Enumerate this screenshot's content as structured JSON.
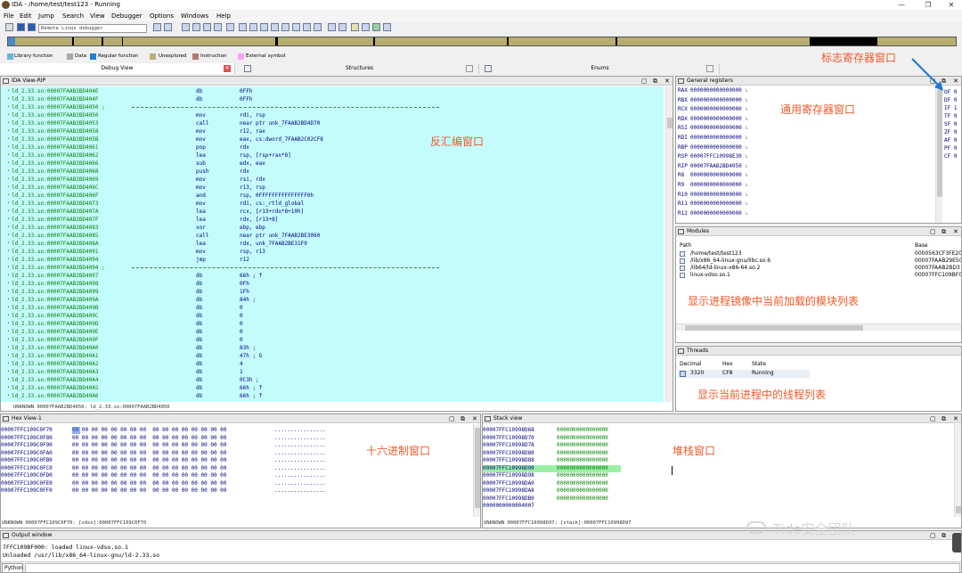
{
  "window": {
    "title": "IDA - /home/test/test123 - Running",
    "min": "—",
    "max": "❐",
    "close": "✕"
  },
  "menu": [
    "File",
    "Edit",
    "Jump",
    "Search",
    "View",
    "Debugger",
    "Options",
    "Windows",
    "Help"
  ],
  "debugger_select": "Remote Linux debugger",
  "legend": [
    {
      "label": "Library function",
      "color": "#69b3d7"
    },
    {
      "label": "Data",
      "color": "#a8a8a8"
    },
    {
      "label": "Regular function",
      "color": "#1f7ed6"
    },
    {
      "label": "Unexplored",
      "color": "#b9b17a"
    },
    {
      "label": "Instruction",
      "color": "#b3796b"
    },
    {
      "label": "External symbol",
      "color": "#ff9ff5"
    }
  ],
  "tabs": [
    {
      "label": "Debug View"
    },
    {
      "label": "Structures"
    },
    {
      "label": "Enums"
    }
  ],
  "ida_view": {
    "title": "IDA View-RIP",
    "status": "UNKNOWN 00007FAAB2BD4050: ld_2.33.so:00007FAAB2BD4050",
    "lines": [
      {
        "addr": "ld_2.33.so:00007FAAB2BD404E",
        "mn": "db",
        "op": "0FFh"
      },
      {
        "addr": "ld_2.33.so:00007FAAB2BD404F",
        "mn": "db",
        "op": "0FFh"
      },
      {
        "addr": "ld_2.33.so:00007FAAB2BD4050 ;",
        "mn": "",
        "op": ""
      },
      {
        "addr": "ld_2.33.so:00007FAAB2BD4050",
        "mn": "mov",
        "op": "rdi, rsp"
      },
      {
        "addr": "ld_2.33.so:00007FAAB2BD4053",
        "mn": "call",
        "op": "near ptr unk_7FAAB2BD4D70"
      },
      {
        "addr": "ld_2.33.so:00007FAAB2BD4058",
        "mn": "mov",
        "op": "r12, rax"
      },
      {
        "addr": "ld_2.33.so:00007FAAB2BD405B",
        "mn": "mov",
        "op": "eax, cs:dword_7FAAB2C02CF8"
      },
      {
        "addr": "ld_2.33.so:00007FAAB2BD4061",
        "mn": "pop",
        "op": "rdx"
      },
      {
        "addr": "ld_2.33.so:00007FAAB2BD4062",
        "mn": "lea",
        "op": "rsp, [rsp+rax*8]"
      },
      {
        "addr": "ld_2.33.so:00007FAAB2BD4066",
        "mn": "sub",
        "op": "edx, eax"
      },
      {
        "addr": "ld_2.33.so:00007FAAB2BD4068",
        "mn": "push",
        "op": "rdx"
      },
      {
        "addr": "ld_2.33.so:00007FAAB2BD4069",
        "mn": "mov",
        "op": "rsi, rdx"
      },
      {
        "addr": "ld_2.33.so:00007FAAB2BD406C",
        "mn": "mov",
        "op": "r13, rsp"
      },
      {
        "addr": "ld_2.33.so:00007FAAB2BD406F",
        "mn": "and",
        "op": "rsp, 0FFFFFFFFFFFFFFF0h"
      },
      {
        "addr": "ld_2.33.so:00007FAAB2BD4073",
        "mn": "mov",
        "op": "rdi, cs:_rtld_global"
      },
      {
        "addr": "ld_2.33.so:00007FAAB2BD407A",
        "mn": "lea",
        "op": "rcx, [r13+rdx*8+10h]"
      },
      {
        "addr": "ld_2.33.so:00007FAAB2BD407F",
        "mn": "lea",
        "op": "rdx, [r13+8]"
      },
      {
        "addr": "ld_2.33.so:00007FAAB2BD4083",
        "mn": "xor",
        "op": "ebp, ebp"
      },
      {
        "addr": "ld_2.33.so:00007FAAB2BD4085",
        "mn": "call",
        "op": "near ptr unk_7FAAB2BE3060"
      },
      {
        "addr": "ld_2.33.so:00007FAAB2BD408A",
        "mn": "lea",
        "op": "rdx, unk_7FAAB2BE31F0"
      },
      {
        "addr": "ld_2.33.so:00007FAAB2BD4091",
        "mn": "mov",
        "op": "rsp, r13"
      },
      {
        "addr": "ld_2.33.so:00007FAAB2BD4094",
        "mn": "jmp",
        "op": "r12"
      },
      {
        "addr": "ld_2.33.so:00007FAAB2BD4094 ;",
        "mn": "",
        "op": ""
      },
      {
        "addr": "ld_2.33.so:00007FAAB2BD4097",
        "mn": "db",
        "op": "66h ; f"
      },
      {
        "addr": "ld_2.33.so:00007FAAB2BD4098",
        "mn": "db",
        "op": "0Fh"
      },
      {
        "addr": "ld_2.33.so:00007FAAB2BD4099",
        "mn": "db",
        "op": "1Fh"
      },
      {
        "addr": "ld_2.33.so:00007FAAB2BD409A",
        "mn": "db",
        "op": "84h ;"
      },
      {
        "addr": "ld_2.33.so:00007FAAB2BD409B",
        "mn": "db",
        "op": "0"
      },
      {
        "addr": "ld_2.33.so:00007FAAB2BD409C",
        "mn": "db",
        "op": "0"
      },
      {
        "addr": "ld_2.33.so:00007FAAB2BD409D",
        "mn": "db",
        "op": "0"
      },
      {
        "addr": "ld_2.33.so:00007FAAB2BD409E",
        "mn": "db",
        "op": "0"
      },
      {
        "addr": "ld_2.33.so:00007FAAB2BD409F",
        "mn": "db",
        "op": "0"
      },
      {
        "addr": "ld_2.33.so:00007FAAB2BD40A0",
        "mn": "db",
        "op": "83h ;"
      },
      {
        "addr": "ld_2.33.so:00007FAAB2BD40A1",
        "mn": "db",
        "op": "47h ; G"
      },
      {
        "addr": "ld_2.33.so:00007FAAB2BD40A2",
        "mn": "db",
        "op": "4"
      },
      {
        "addr": "ld_2.33.so:00007FAAB2BD40A3",
        "mn": "db",
        "op": "1"
      },
      {
        "addr": "ld_2.33.so:00007FAAB2BD40A4",
        "mn": "db",
        "op": "0C3h ;"
      },
      {
        "addr": "ld_2.33.so:00007FAAB2BD40A5",
        "mn": "db",
        "op": "66h ; f"
      },
      {
        "addr": "ld_2.33.so:00007FAAB2BD40A6",
        "mn": "db",
        "op": "66h ; f"
      }
    ]
  },
  "registers": {
    "title": "General registers",
    "rows": [
      {
        "name": "RAX",
        "val": "0000000000000000"
      },
      {
        "name": "RBX",
        "val": "0000000000000000"
      },
      {
        "name": "RCX",
        "val": "0000000000000000"
      },
      {
        "name": "RDX",
        "val": "0000000000000000"
      },
      {
        "name": "RSI",
        "val": "0000000000000000"
      },
      {
        "name": "RDI",
        "val": "0000000000000000"
      },
      {
        "name": "RBP",
        "val": "0000000000000000"
      },
      {
        "name": "RSP",
        "val": "00007FFC10998E30"
      },
      {
        "name": "RIP",
        "val": "00007FAAB2BD4050"
      },
      {
        "name": "R8",
        "val": "0000000000000000"
      },
      {
        "name": "R9",
        "val": "0000000000000000"
      },
      {
        "name": "R10",
        "val": "0000000000000000"
      },
      {
        "name": "R11",
        "val": "0000000000000000"
      },
      {
        "name": "R12",
        "val": "0000000000000000"
      }
    ],
    "flags": [
      "OF 0",
      "DF 0",
      "IF 1",
      "TF 0",
      "SF 0",
      "ZF 0",
      "AF 0",
      "PF 0",
      "CF 0"
    ]
  },
  "modules": {
    "title": "Modules",
    "col_path": "Path",
    "col_base": "Base",
    "rows": [
      {
        "path": "/home/test/test123",
        "base": "0000563CF3FE20"
      },
      {
        "path": "/lib/x86_64-linux-gnu/libc.so.6",
        "base": "00007FAAB29E50"
      },
      {
        "path": "/lib64/ld-linux-x86-64.so.2",
        "base": "00007FAAB2BD3"
      },
      {
        "path": "linux-vdso.so.1",
        "base": "00007FFC109BF0"
      }
    ]
  },
  "threads": {
    "title": "Threads",
    "cols": [
      "Decimal",
      "Hex",
      "State"
    ],
    "rows": [
      {
        "dec": "3320",
        "hex": "CF8",
        "state": "Running"
      }
    ]
  },
  "hexview": {
    "title": "Hex View-1",
    "status": "UNKNOWN 00007FFC109C0F70: [vdso]:00007FFC109C0F70",
    "rows": [
      {
        "addr": "00007FFC109C0F70",
        "bytes": "00 00 00 00 00 00 00 00  00 00 00 00 00 00 00 00",
        "ascii": "................"
      },
      {
        "addr": "00007FFC109C0F80",
        "bytes": "00 00 00 00 00 00 00 00  00 00 00 00 00 00 00 00",
        "ascii": "................"
      },
      {
        "addr": "00007FFC109C0F90",
        "bytes": "00 00 00 00 00 00 00 00  00 00 00 00 00 00 00 00",
        "ascii": "................"
      },
      {
        "addr": "00007FFC109C0FA0",
        "bytes": "00 00 00 00 00 00 00 00  00 00 00 00 00 00 00 00",
        "ascii": "................"
      },
      {
        "addr": "00007FFC109C0FB0",
        "bytes": "00 00 00 00 00 00 00 00  00 00 00 00 00 00 00 00",
        "ascii": "................"
      },
      {
        "addr": "00007FFC109C0FC0",
        "bytes": "00 00 00 00 00 00 00 00  00 00 00 00 00 00 00 00",
        "ascii": "................"
      },
      {
        "addr": "00007FFC109C0FD0",
        "bytes": "00 00 00 00 00 00 00 00  00 00 00 00 00 00 00 00",
        "ascii": "................"
      },
      {
        "addr": "00007FFC109C0FE0",
        "bytes": "00 00 00 00 00 00 00 00  00 00 00 00 00 00 00 00",
        "ascii": "................"
      },
      {
        "addr": "00007FFC109C0FF0",
        "bytes": "00 00 00 00 00 00 00 00  00 00 00 00 00 00 00 00",
        "ascii": "................"
      }
    ]
  },
  "stack": {
    "title": "Stack view",
    "status": "UNKNOWN 00007FFC10998D97: [stack]:00007FFC10998D97",
    "rows": [
      {
        "addr": "00007FFC10998D68",
        "val": "0000000000000000"
      },
      {
        "addr": "00007FFC10998D70",
        "val": "0000000000000000"
      },
      {
        "addr": "00007FFC10998D78",
        "val": "0000000000000000"
      },
      {
        "addr": "00007FFC10998D80",
        "val": "0000000000000000"
      },
      {
        "addr": "00007FFC10998D88",
        "val": "0000000000000000"
      },
      {
        "addr": "00007FFC10998D90",
        "val": "0000000000000000"
      },
      {
        "addr": "00007FFC10998D98",
        "val": "0000000000000000"
      },
      {
        "addr": "00007FFC10998DA0",
        "val": "0000000000000000"
      },
      {
        "addr": "00007FFC10998DA8",
        "val": "0000000000000000"
      },
      {
        "addr": "00007FFC10998DB0",
        "val": "0000000000000000"
      },
      {
        "addr": "0000000000004007",
        "val": ""
      }
    ]
  },
  "output": {
    "title": "Output window",
    "lines": [
      "7FFC109BF000: loaded linux-vdso.so.1",
      "Unloaded /usr/lib/x86_64-linux-gnu/ld-2.33.so"
    ],
    "lang": "Python"
  },
  "annotations": {
    "flags": "标志寄存器窗口",
    "registers": "通用寄存器窗口",
    "disasm": "反汇编窗口",
    "modules": "显示进程镜像中当前加载的模块列表",
    "threads": "显示当前进程中的线程列表",
    "hex": "十六进制窗口",
    "stack": "堆栈窗口"
  },
  "watermark": "Tide安全团队"
}
